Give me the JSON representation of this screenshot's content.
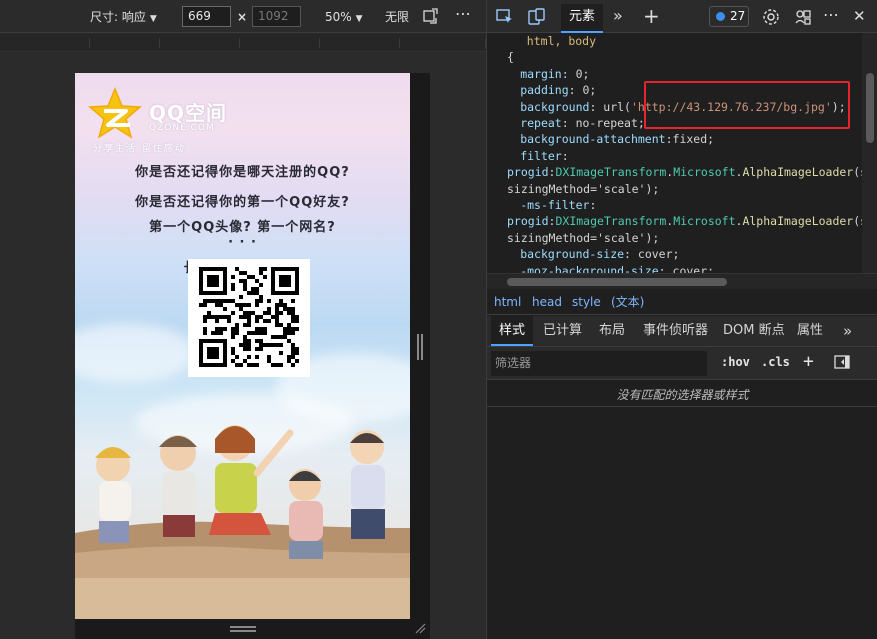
{
  "emulation_toolbar": {
    "size_label": "尺寸: 响应",
    "width_value": "669",
    "height_placeholder": "1092",
    "times": "×",
    "zoom": "50%",
    "throttle": "无限",
    "more": "⋯"
  },
  "qzone_page": {
    "logo_title": "QQ空间",
    "logo_domain": "QZONE.COM",
    "logo_slogan": "分享生活  留住感动",
    "lines": [
      "你是否还记得你是哪天注册的QQ?",
      "你是否还记得你的第一个QQ好友?",
      "第一个QQ头像? 第一个网名?",
      "· · ·",
      "长按二维码          人轨迹"
    ]
  },
  "devtools_toolbar": {
    "tab_elements": "元素",
    "more_tabs": "»",
    "add_tab": "+",
    "issues_count": "27",
    "more": "⋯",
    "close": "✕"
  },
  "code": {
    "lines": [
      {
        "indent": 3,
        "parts": [
          {
            "t": "html, body",
            "c": "sel"
          }
        ]
      },
      {
        "indent": 0,
        "parts": [
          {
            "t": "{",
            "c": ""
          }
        ]
      },
      {
        "indent": 2,
        "parts": [
          {
            "t": "margin",
            "c": "prop"
          },
          {
            "t": ": 0;",
            "c": ""
          }
        ]
      },
      {
        "indent": 2,
        "parts": [
          {
            "t": "padding",
            "c": "prop"
          },
          {
            "t": ": 0;",
            "c": ""
          }
        ]
      },
      {
        "indent": 2,
        "parts": [
          {
            "t": "background",
            "c": "prop"
          },
          {
            "t": ": url(",
            "c": ""
          },
          {
            "t": "'http://43.129.76.237/bg.jpg'",
            "c": "url"
          },
          {
            "t": ");",
            "c": ""
          }
        ]
      },
      {
        "indent": 2,
        "parts": [
          {
            "t": "repeat",
            "c": "prop"
          },
          {
            "t": ": no-repeat;",
            "c": ""
          }
        ]
      },
      {
        "indent": 2,
        "parts": [
          {
            "t": "background-attachment",
            "c": "prop"
          },
          {
            "t": ":fixed;",
            "c": ""
          }
        ]
      },
      {
        "indent": 2,
        "parts": [
          {
            "t": "filter",
            "c": "prop"
          },
          {
            "t": ":",
            "c": ""
          }
        ]
      },
      {
        "indent": 0,
        "parts": [
          {
            "t": "progid",
            "c": "prop"
          },
          {
            "t": ":",
            "c": ""
          },
          {
            "t": "DXImageTransform",
            "c": "cls"
          },
          {
            "t": ".",
            "c": ""
          },
          {
            "t": "Microsoft",
            "c": "cls"
          },
          {
            "t": ".",
            "c": ""
          },
          {
            "t": "AlphaImageLoader",
            "c": "fn"
          },
          {
            "t": "(src",
            "c": ""
          }
        ]
      },
      {
        "indent": 0,
        "parts": [
          {
            "t": "sizingMethod='scale');",
            "c": ""
          }
        ]
      },
      {
        "indent": 2,
        "parts": [
          {
            "t": "-ms-filter",
            "c": "prop"
          },
          {
            "t": ":",
            "c": ""
          }
        ]
      },
      {
        "indent": 0,
        "parts": [
          {
            "t": "progid",
            "c": "prop"
          },
          {
            "t": ":",
            "c": ""
          },
          {
            "t": "DXImageTransform",
            "c": "cls"
          },
          {
            "t": ".",
            "c": ""
          },
          {
            "t": "Microsoft",
            "c": "cls"
          },
          {
            "t": ".",
            "c": ""
          },
          {
            "t": "AlphaImageLoader",
            "c": "fn"
          },
          {
            "t": "(src",
            "c": ""
          }
        ]
      },
      {
        "indent": 0,
        "parts": [
          {
            "t": "sizingMethod='scale');",
            "c": ""
          }
        ]
      },
      {
        "indent": 2,
        "parts": [
          {
            "t": "background-size",
            "c": "prop"
          },
          {
            "t": ": cover;",
            "c": ""
          }
        ]
      },
      {
        "indent": 2,
        "parts": [
          {
            "t": "-moz-background-size",
            "c": "prop"
          },
          {
            "t": ": cover;",
            "c": ""
          }
        ]
      }
    ]
  },
  "breadcrumb": {
    "items": [
      "html",
      "head",
      "style",
      "(文本)"
    ]
  },
  "styles_tabs": {
    "items": [
      "样式",
      "已计算",
      "布局",
      "事件侦听器",
      "DOM 断点",
      "属性",
      "»"
    ]
  },
  "filter": {
    "placeholder": "筛选器",
    "hov": ":hov",
    "cls": ".cls",
    "add": "+"
  },
  "styles_pane": {
    "empty_message": "没有匹配的选择器或样式"
  },
  "colors": {
    "accent": "#4da3ff",
    "highlight_box": "#e8242d"
  }
}
